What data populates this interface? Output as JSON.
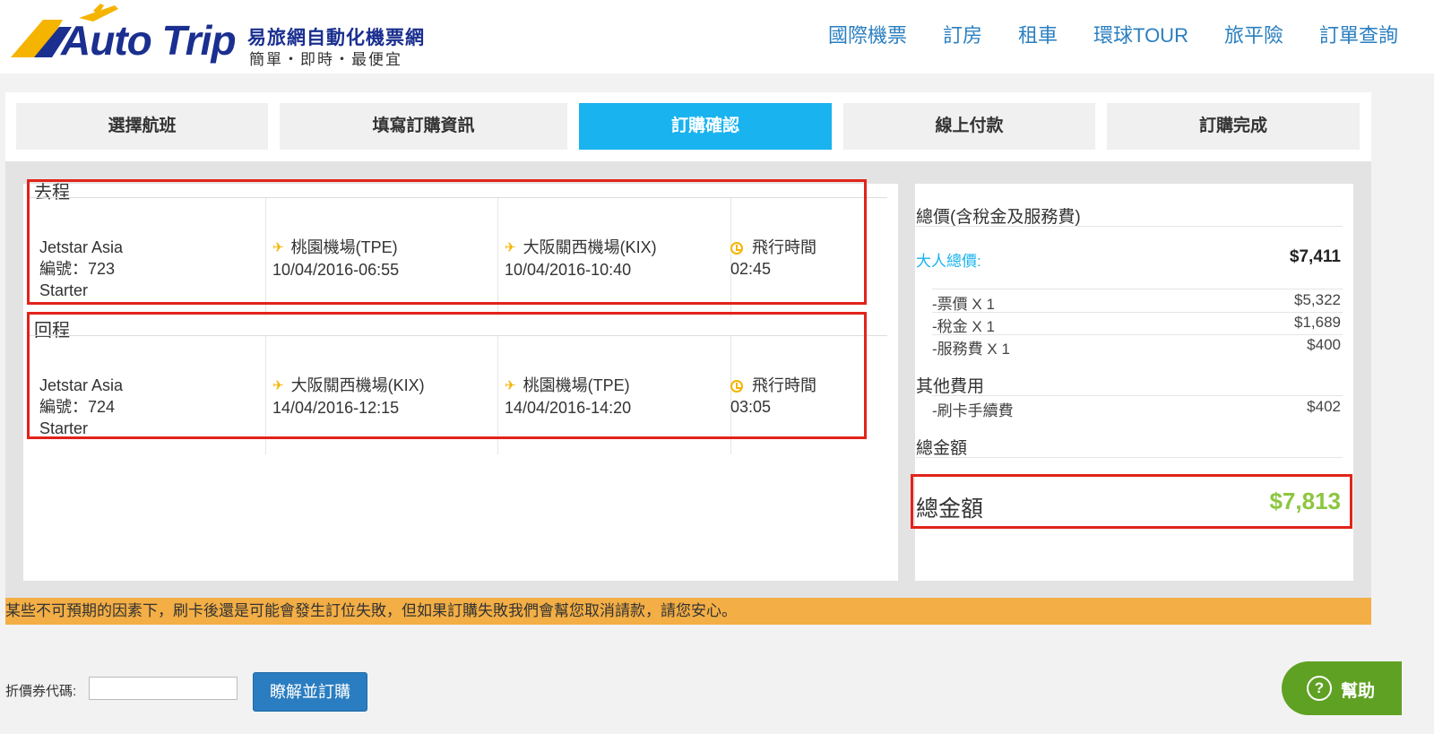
{
  "header": {
    "logo_text": "Auto Trip",
    "logo_zh": "易旅網自動化機票網",
    "logo_slogan": "簡單・即時・最便宜",
    "nav": [
      "國際機票",
      "訂房",
      "租車",
      "環球TOUR",
      "旅平險",
      "訂單查詢"
    ]
  },
  "steps": [
    {
      "label": "選擇航班",
      "active": false
    },
    {
      "label": "填寫訂購資訊",
      "active": false
    },
    {
      "label": "訂購確認",
      "active": true
    },
    {
      "label": "線上付款",
      "active": false
    },
    {
      "label": "訂購完成",
      "active": false
    }
  ],
  "segments": [
    {
      "title": "去程",
      "airline": "Jetstar Asia",
      "flight_no": "編號：723",
      "fare_class": "Starter",
      "depart_airport": "桃園機場(TPE)",
      "depart_time": "10/04/2016-06:55",
      "arrive_airport": "大阪關西機場(KIX)",
      "arrive_time": "10/04/2016-10:40",
      "duration_label": "飛行時間",
      "duration": "02:45"
    },
    {
      "title": "回程",
      "airline": "Jetstar Asia",
      "flight_no": "編號：724",
      "fare_class": "Starter",
      "depart_airport": "大阪關西機場(KIX)",
      "depart_time": "14/04/2016-12:15",
      "arrive_airport": "桃園機場(TPE)",
      "arrive_time": "14/04/2016-14:20",
      "duration_label": "飛行時間",
      "duration": "03:05"
    }
  ],
  "price": {
    "heading": "總價(含稅金及服務費)",
    "adult_label": "大人總價:",
    "adult_total": "$7,411",
    "breakdown": [
      {
        "label": "-票價 X 1",
        "value": "$5,322"
      },
      {
        "label": "-稅金 X 1",
        "value": "$1,689"
      },
      {
        "label": "-服務費 X 1",
        "value": "$400"
      }
    ],
    "other_heading": "其他費用",
    "other_items": [
      {
        "label": "-刷卡手續費",
        "value": "$402"
      }
    ],
    "total_heading": "總金額",
    "total_label": "總金額",
    "total_value": "$7,813",
    "colors": {
      "adult_label": "#19b3ef",
      "total_value": "#8cc63f"
    }
  },
  "notice": "某些不可預期的因素下，刷卡後還是可能會發生訂位失敗，但如果訂購失敗我們會幫您取消請款，請您安心。",
  "coupon": {
    "label": "折價券代碼:",
    "value": "",
    "submit_label": "瞭解並訂購"
  },
  "help": {
    "icon": "?",
    "label": "幫助"
  }
}
